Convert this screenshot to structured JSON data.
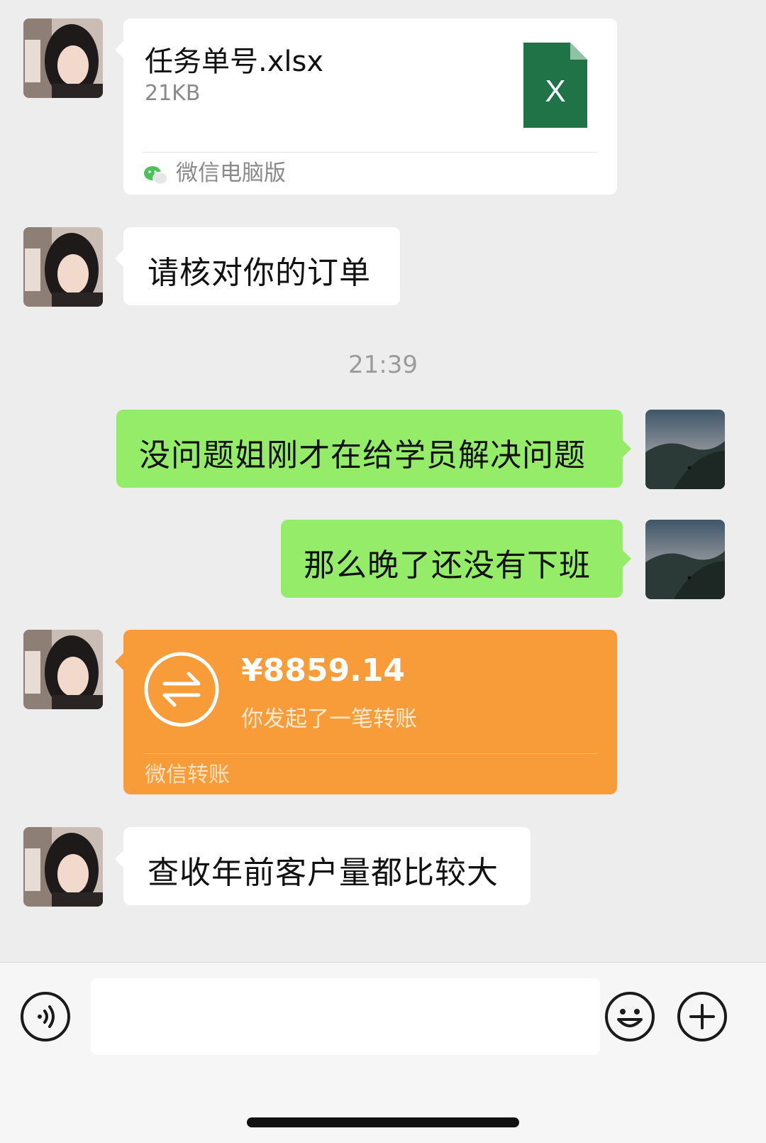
{
  "colors": {
    "background": "#EDEDED",
    "incoming_bubble": "#FFFFFF",
    "outgoing_bubble": "#95EC69",
    "transfer_bubble": "#F89C3A",
    "excel_icon": "#1F7346"
  },
  "messages": {
    "file_card": {
      "sender": "contact",
      "file_name": "任务单号.xlsx",
      "file_size": "21KB",
      "file_icon": "excel-file-icon",
      "file_icon_letter": "X",
      "source_label": "微信电脑版",
      "source_icon": "wechat-icon"
    },
    "incoming_1": {
      "sender": "contact",
      "text": "请核对你的订单"
    },
    "timestamp": "21:39",
    "outgoing_1": {
      "sender": "me",
      "text": "没问题姐刚才在给学员解决问题"
    },
    "outgoing_2": {
      "sender": "me",
      "text": "那么晚了还没有下班"
    },
    "transfer": {
      "sender": "contact",
      "amount": "¥8859.14",
      "description": "你发起了一笔转账",
      "footer": "微信转账",
      "icon": "transfer-icon"
    },
    "incoming_2": {
      "sender": "contact",
      "text": "查收年前客户量都比较大"
    }
  },
  "input_bar": {
    "voice_icon": "voice-icon",
    "emoji_icon": "emoji-icon",
    "add_icon": "plus-icon",
    "input_value": ""
  }
}
